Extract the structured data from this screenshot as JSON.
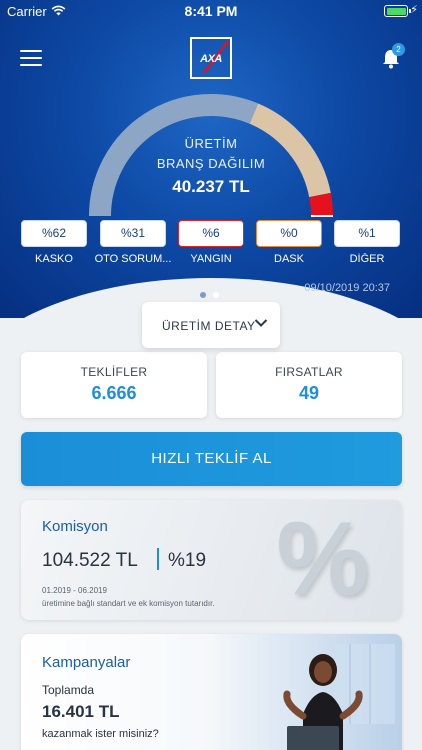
{
  "status_bar": {
    "carrier": "Carrier",
    "time": "8:41 PM"
  },
  "header": {
    "logo_text": "AXA",
    "notification_count": "2"
  },
  "gauge": {
    "title_line1": "ÜRETİM",
    "title_line2": "BRANŞ DAĞILIM",
    "total": "40.237 TL",
    "segments": [
      {
        "name": "KASKO",
        "percent": 62,
        "color": "#8ea6c6"
      },
      {
        "name": "OTO SORUM...",
        "percent": 31,
        "color": "#dcc5a7"
      },
      {
        "name": "YANGIN",
        "percent": 6,
        "color": "#e5111c"
      }
    ]
  },
  "branches": [
    {
      "value": "%62",
      "label": "KASKO"
    },
    {
      "value": "%31",
      "label": "OTO SORUM..."
    },
    {
      "value": "%6",
      "label": "YANGIN"
    },
    {
      "value": "%0",
      "label": "DASK"
    },
    {
      "value": "%1",
      "label": "DİĞER"
    }
  ],
  "pager": {
    "pages": 2,
    "active": 2
  },
  "hero_date": "09/10/2019 20:37",
  "detail_button": {
    "label": "ÜRETİM DETAY"
  },
  "stats": {
    "offers": {
      "title": "TEKLİFLER",
      "value": "6.666"
    },
    "opportunities": {
      "title": "FIRSATLAR",
      "value": "49"
    }
  },
  "cta": {
    "label": "HIZLI TEKLİF AL"
  },
  "commission": {
    "title": "Komisyon",
    "amount": "104.522 TL",
    "percent": "%19",
    "range": "01.2019 - 06.2019",
    "description": "üretimine bağlı standart ve ek komisyon tutarıdır.",
    "decor": "%"
  },
  "campaigns": {
    "title": "Kampanyalar",
    "subtitle": "Toplamda",
    "amount": "16.401 TL",
    "question": "kazanmak ister misiniz?"
  },
  "colors": {
    "accent": "#1f8ed6",
    "hero": "#0d49a5"
  }
}
